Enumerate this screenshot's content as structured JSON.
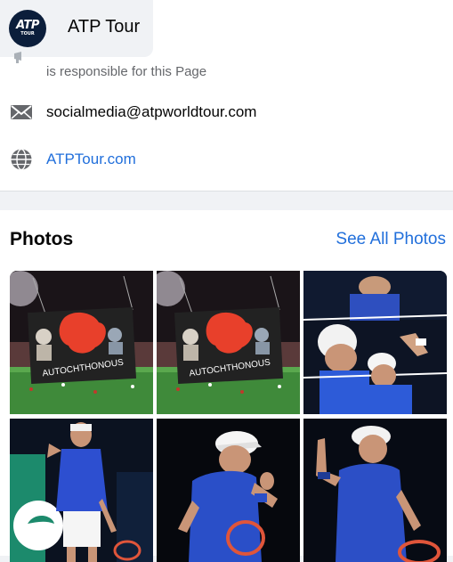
{
  "header": {
    "page_name": "ATP Tour",
    "logo_main": "ATP",
    "logo_sub": "TOUR"
  },
  "about": {
    "responsibility_text": "is responsible for this Page",
    "email": "socialmedia@atpworldtour.com",
    "website": "ATPTour.com"
  },
  "photos": {
    "title": "Photos",
    "see_all": "See All Photos",
    "banner_text": "AUTOCHTHONOUS",
    "items": [
      {
        "kind": "stadium-banner"
      },
      {
        "kind": "stadium-banner"
      },
      {
        "kind": "player-collage"
      },
      {
        "kind": "player-blue-shirt"
      },
      {
        "kind": "player-white-cap"
      },
      {
        "kind": "player-pointing"
      }
    ]
  },
  "colors": {
    "link": "#216fdb",
    "logo_bg": "#0b1e3b",
    "divider": "#dddfe2",
    "page_bg": "#f0f2f5"
  }
}
